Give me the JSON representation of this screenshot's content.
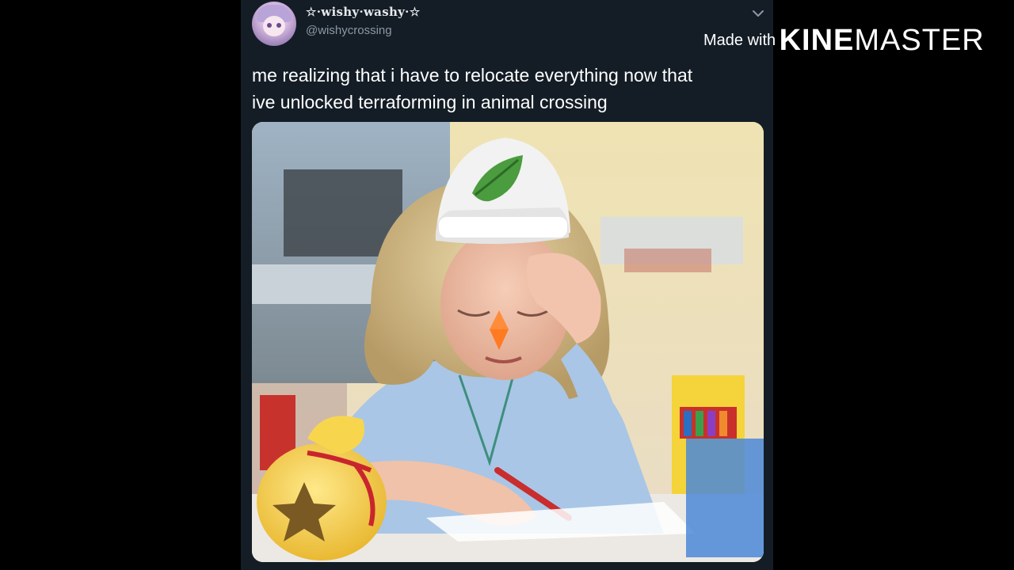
{
  "tweet": {
    "display_name": "☆·wishy·washy·☆",
    "handle": "@wishycrossing",
    "text_line_1": "me realizing that i have to relocate everything now that",
    "text_line_2": "ive unlocked terraforming in animal crossing",
    "menu_icon": "chevron-down-icon",
    "avatar_icon": "anime-avatar"
  },
  "media": {
    "description_icon": "crying-girl-photo",
    "overlays": [
      "hard-hat-leaf-icon",
      "bell-bag-icon",
      "crayon-box"
    ]
  },
  "watermark": {
    "made_with": "Made with",
    "brand_bold": "KINE",
    "brand_light": "MASTER"
  },
  "colors": {
    "background": "#000000",
    "card": "#141d26",
    "text": "#ffffff",
    "handle": "#8b98a5"
  }
}
